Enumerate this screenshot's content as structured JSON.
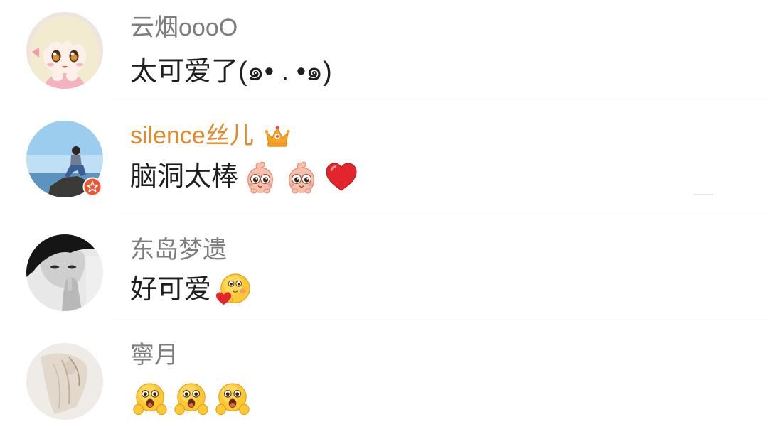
{
  "comments": [
    {
      "username": "云烟oooO",
      "text": "太可爱了(๑• . •๑)",
      "emojis": []
    },
    {
      "username": "silence丝儿",
      "member_icon": "crown-icon",
      "avatar_badge": "star-badge-icon",
      "text": "脑洞太棒",
      "emojis": [
        "pink-creature-emoji",
        "pink-creature-emoji",
        "red-heart-emoji"
      ]
    },
    {
      "username": "东岛梦遗",
      "text": "好可爱",
      "emojis": [
        "blushing-heart-emoji"
      ]
    },
    {
      "username": "寧月",
      "emojis": [
        "hands-face-emoji",
        "hands-face-emoji",
        "hands-face-emoji"
      ]
    }
  ],
  "colors": {
    "username": "#7d7d7d",
    "vip_username": "#e3892c",
    "comment_text": "#1e1e1e",
    "divider": "#e6e6e6",
    "background": "#ffffff",
    "badge": "#f3532f"
  }
}
